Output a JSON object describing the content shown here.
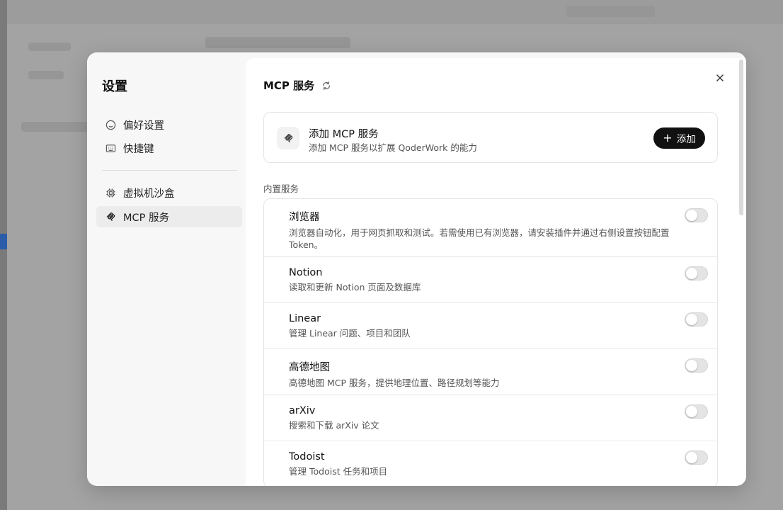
{
  "sidebar": {
    "title": "设置",
    "items": [
      {
        "label": "偏好设置",
        "icon": "smiley-icon"
      },
      {
        "label": "快捷键",
        "icon": "keyboard-icon"
      },
      {
        "label": "虚拟机沙盒",
        "icon": "chip-icon"
      },
      {
        "label": "MCP 服务",
        "icon": "mcp-icon",
        "active": true
      }
    ]
  },
  "content": {
    "title": "MCP 服务",
    "add_card": {
      "title": "添加 MCP 服务",
      "subtitle": "添加 MCP 服务以扩展 QoderWork 的能力",
      "button_label": "添加"
    },
    "section_label": "内置服务",
    "services": [
      {
        "name": "浏览器",
        "desc": "浏览器自动化，用于网页抓取和测试。若需使用已有浏览器，请安装插件并通过右侧设置按钮配置Token。",
        "enabled": false
      },
      {
        "name": "Notion",
        "desc": "读取和更新 Notion 页面及数据库",
        "enabled": false
      },
      {
        "name": "Linear",
        "desc": "管理 Linear 问题、项目和团队",
        "enabled": false
      },
      {
        "name": "高德地图",
        "desc": "高德地图 MCP 服务，提供地理位置、路径规划等能力",
        "enabled": false
      },
      {
        "name": "arXiv",
        "desc": "搜索和下载 arXiv 论文",
        "enabled": false
      },
      {
        "name": "Todoist",
        "desc": "管理 Todoist 任务和项目",
        "enabled": false
      }
    ]
  }
}
